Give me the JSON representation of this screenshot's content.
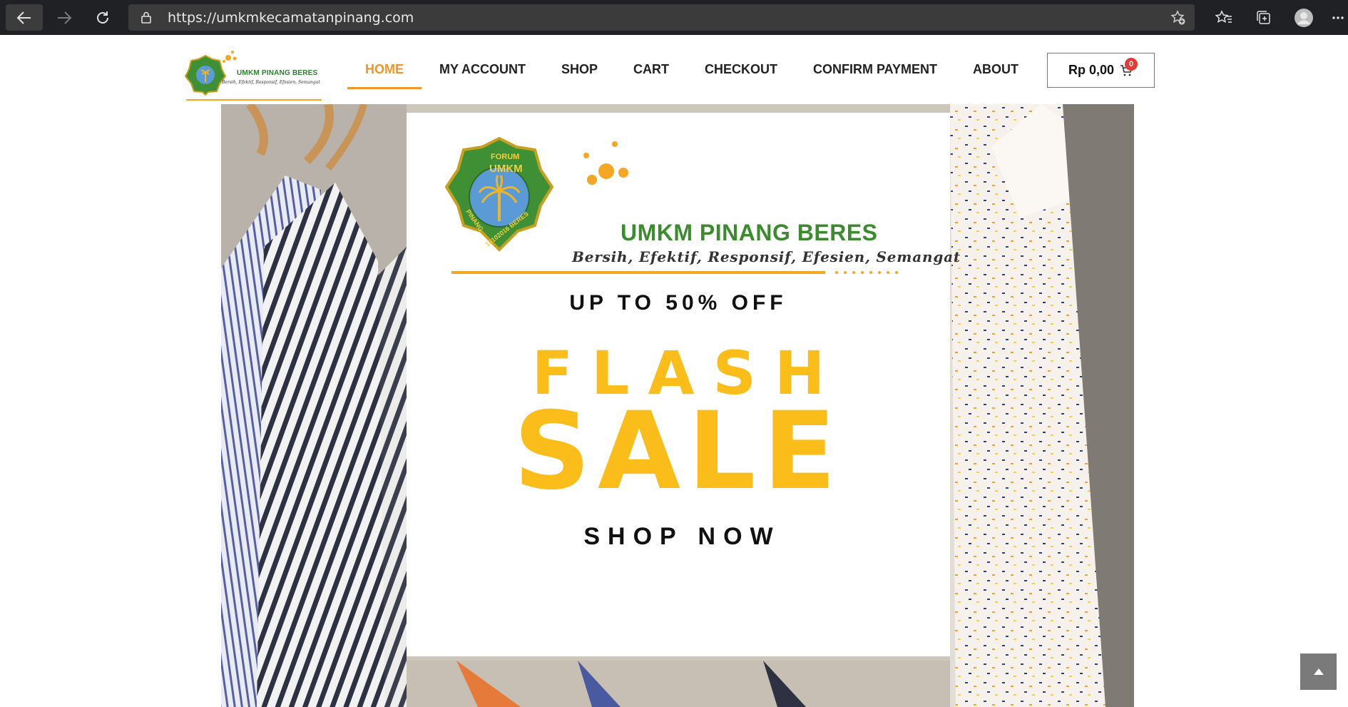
{
  "browser": {
    "url": "https://umkmkecamatanpinang.com",
    "icons": [
      "back-icon",
      "forward-icon",
      "reload-icon",
      "lock-icon",
      "add-favorite-icon",
      "favorites-icon",
      "collections-icon",
      "profile-icon",
      "more-icon"
    ]
  },
  "header": {
    "logo": {
      "title": "UMKM PINANG BERES",
      "tagline": "Bersih, Efektif, Responsif, Efesien, Semangat"
    },
    "menu": [
      {
        "label": "HOME",
        "active": true
      },
      {
        "label": "MY ACCOUNT",
        "active": false
      },
      {
        "label": "SHOP",
        "active": false
      },
      {
        "label": "CART",
        "active": false
      },
      {
        "label": "CHECKOUT",
        "active": false
      },
      {
        "label": "CONFIRM PAYMENT",
        "active": false
      },
      {
        "label": "ABOUT",
        "active": false
      }
    ],
    "cart": {
      "total": "Rp 0,00",
      "count": "0"
    }
  },
  "hero": {
    "badge_top": "FORUM",
    "badge_mid": "UMKM",
    "badge_ring_left": "PINANG",
    "badge_ring_right": "15102016 BERES",
    "brand_title": "UMKM PINANG BERES",
    "brand_tagline": "Bersih, Efektif, Responsif, Efesien, Semangat",
    "offer": "UP TO 50% OFF",
    "headline_1": "FLASH",
    "headline_2": "SALE",
    "cta": "SHOP NOW"
  },
  "colors": {
    "accent": "#f0952b",
    "sale_yellow": "#fbbd19",
    "brand_green": "#3d8b2f",
    "badge_red": "#e53935"
  }
}
